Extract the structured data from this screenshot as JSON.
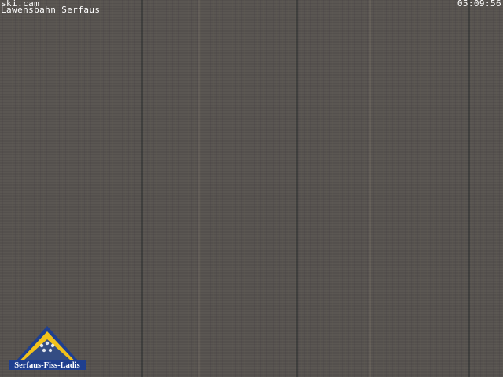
{
  "overlay": {
    "camera_name": "ski.cam",
    "location": "Lawensbahn Serfaus",
    "timestamp": "05:09:56"
  },
  "logo": {
    "text": "Serfaus-Fiss-Ladis",
    "icon": "mountain-triangle-logo",
    "colors": {
      "triangle_outline": "#1f3f8f",
      "triangle_fill": "#f3c21a",
      "banner": "#1f3f8f",
      "text": "#ffffff"
    }
  },
  "image": {
    "description_color": "#57534f"
  }
}
